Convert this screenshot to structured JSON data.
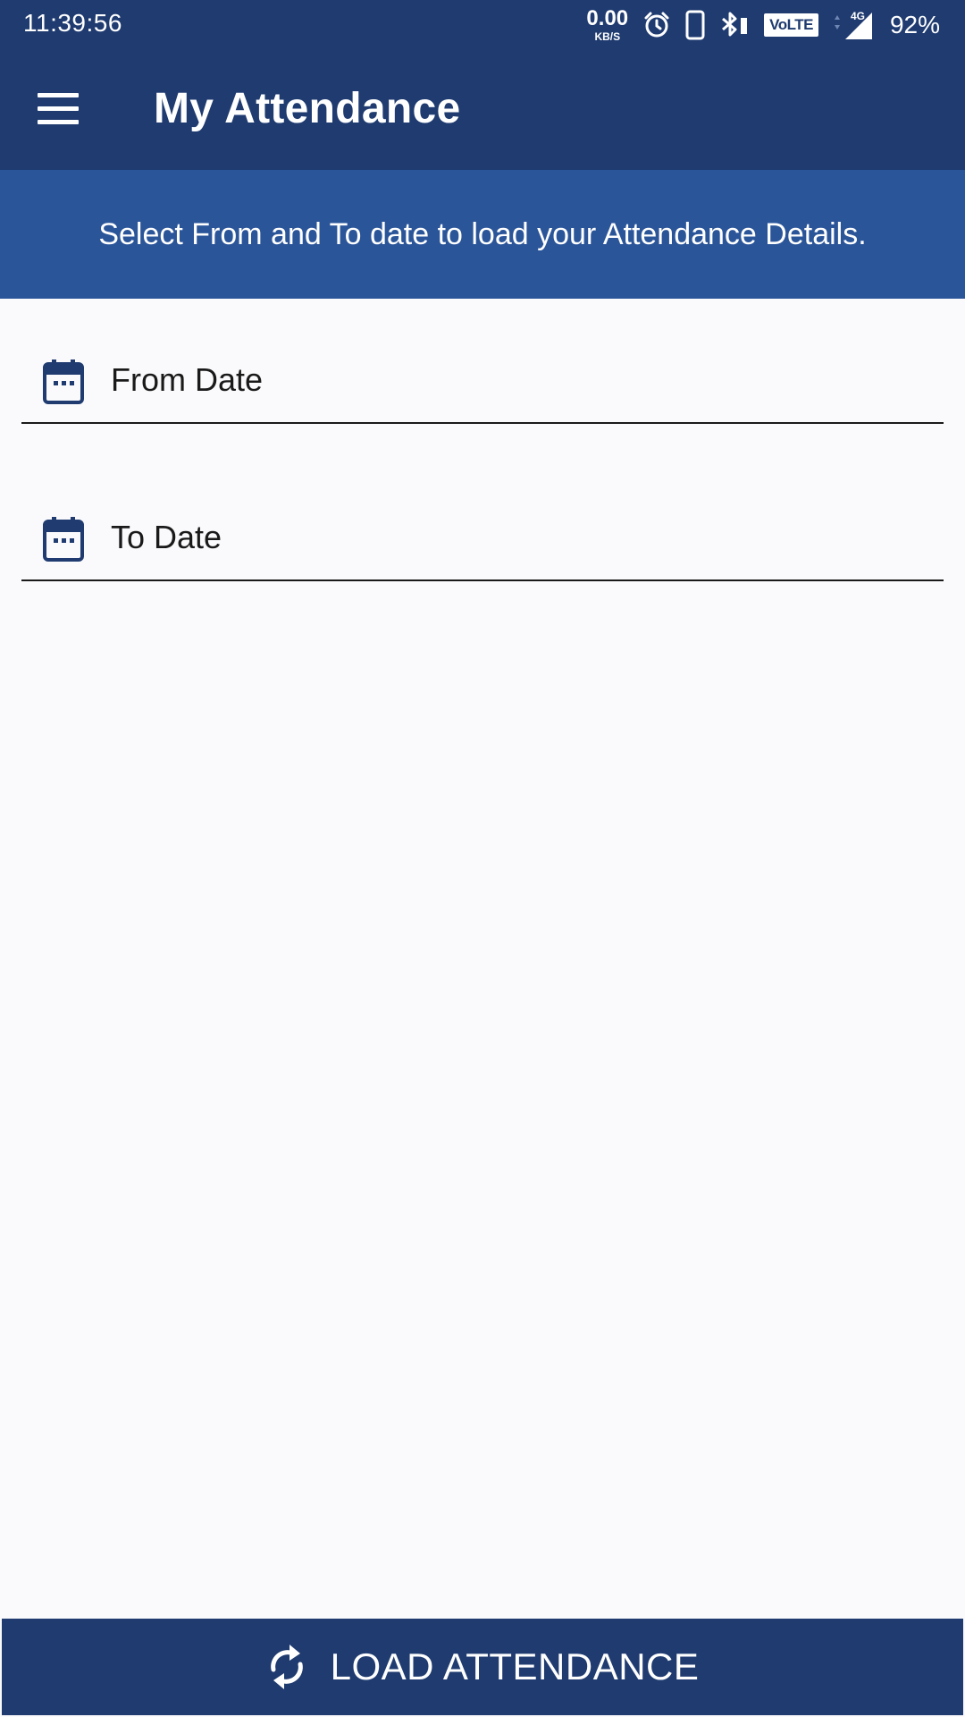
{
  "status_bar": {
    "time": "11:39:56",
    "net_speed_value": "0.00",
    "net_speed_unit": "KB/S",
    "network_label": "VoLTE",
    "network_type": "4G",
    "battery": "92%",
    "icons": [
      "alarm-icon",
      "phone-icon",
      "bluetooth-icon",
      "signal-icon"
    ]
  },
  "app_bar": {
    "title": "My Attendance",
    "menu_icon": "hamburger-menu-icon"
  },
  "banner": {
    "message": "Select From and To date to load your Attendance Details."
  },
  "fields": {
    "from_date": {
      "label": "From Date",
      "icon": "calendar-icon"
    },
    "to_date": {
      "label": "To Date",
      "icon": "calendar-icon"
    }
  },
  "actions": {
    "load_label": "LOAD ATTENDANCE",
    "load_icon": "refresh-icon"
  },
  "colors": {
    "primary": "#1f3b70",
    "banner": "#2b5599",
    "background": "#fafafc",
    "text": "#1a1a1a"
  }
}
